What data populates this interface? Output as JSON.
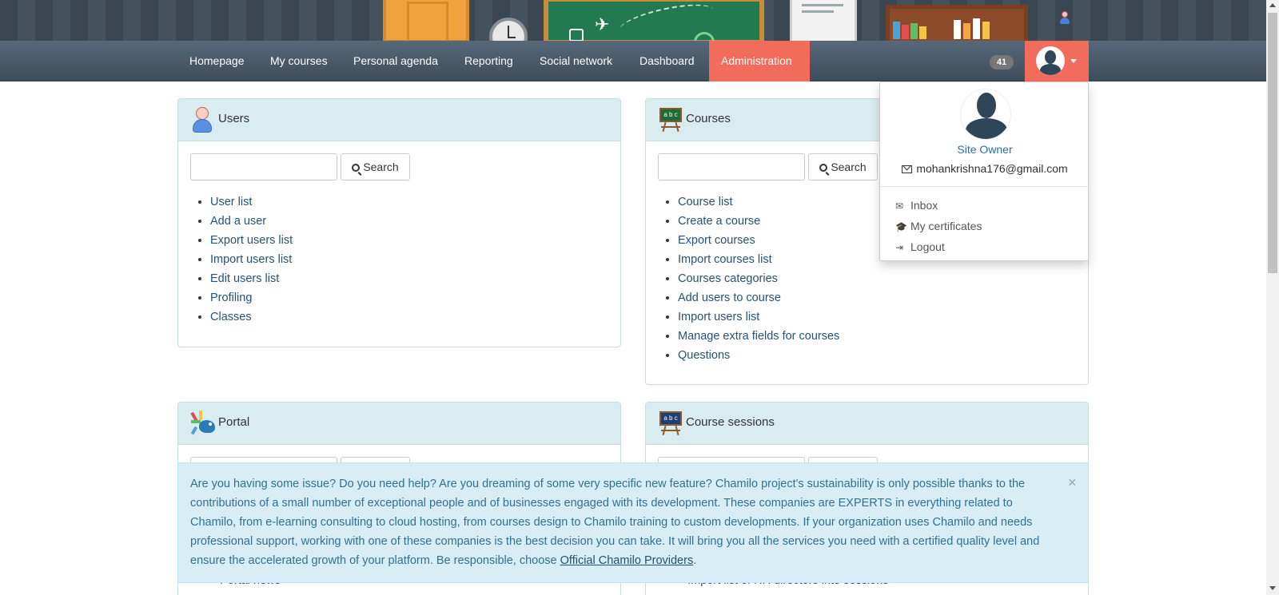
{
  "nav": {
    "items": [
      "Homepage",
      "My courses",
      "Personal agenda",
      "Reporting",
      "Social network",
      "Dashboard",
      "Administration"
    ],
    "active": "Administration",
    "notification_count": "41"
  },
  "user_menu": {
    "name": "Site Owner",
    "email": "mohankrishna176@gmail.com",
    "inbox": "Inbox",
    "certificates": "My certificates",
    "logout": "Logout"
  },
  "panels": {
    "users": {
      "title": "Users",
      "search_label": "Search",
      "links": [
        "User list",
        "Add a user",
        "Export users list",
        "Import users list",
        "Edit users list",
        "Profiling",
        "Classes"
      ]
    },
    "courses": {
      "title": "Courses",
      "search_label": "Search",
      "links": [
        "Course list",
        "Create a course",
        "Export courses",
        "Import courses list",
        "Courses categories",
        "Add users to course",
        "Import users list",
        "Manage extra fields for courses",
        "Questions"
      ]
    },
    "portal": {
      "title": "Portal",
      "partial_link": "Portal news"
    },
    "sessions": {
      "title": "Course sessions",
      "partial_link": "Import list of HR directors into sessions"
    }
  },
  "alert": {
    "text": "Are you having some issue? Do you need help? Are you dreaming of some very specific new feature? Chamilo project's sustainability is only possible thanks to the contributions of a small number of exceptional people and of businesses engaged with its development. These companies are EXPERTS in everything related to Chamilo, from e-learning consulting to cloud hosting, from courses design to Chamilo training to custom developments. If your organization uses Chamilo and needs professional support, working with one of these companies is the best decision you can take. It will bring you all the services you need with a certified quality level and ensure the accelerated growth of your platform. Be responsible, choose ",
    "link": "Official Chamilo Providers",
    "end": ".",
    "close": "×"
  },
  "colors": {
    "accent": "#f26c5b",
    "link": "#23527c",
    "panel_header": "#d9edf1",
    "alert_bg": "#d9edf7",
    "alert_text": "#31708f"
  }
}
